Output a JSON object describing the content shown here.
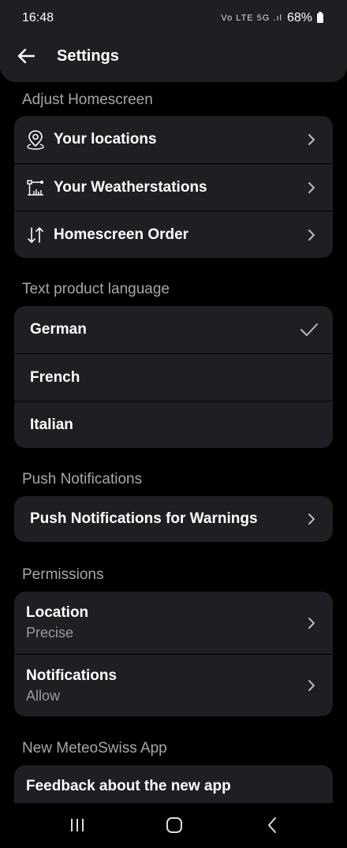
{
  "status": {
    "time": "16:48",
    "battery": "68%",
    "icons": "Vo LTE 5G .ıl"
  },
  "appbar": {
    "title": "Settings"
  },
  "sections": {
    "homescreen": {
      "title": "Adjust Homescreen",
      "items": [
        {
          "label": "Your locations",
          "icon": "location-pin-icon"
        },
        {
          "label": "Your Weatherstations",
          "icon": "weatherstation-icon"
        },
        {
          "label": "Homescreen Order",
          "icon": "sort-arrows-icon"
        }
      ]
    },
    "language": {
      "title": "Text product language",
      "items": [
        {
          "label": "German",
          "selected": true
        },
        {
          "label": "French",
          "selected": false
        },
        {
          "label": "Italian",
          "selected": false
        }
      ]
    },
    "push": {
      "title": "Push Notifications",
      "items": [
        {
          "label": "Push Notifications for Warnings"
        }
      ]
    },
    "permissions": {
      "title": "Permissions",
      "items": [
        {
          "label": "Location",
          "value": "Precise"
        },
        {
          "label": "Notifications",
          "value": "Allow"
        }
      ]
    },
    "newapp": {
      "title": "New MeteoSwiss App",
      "items": [
        {
          "label": "Feedback about the new app"
        }
      ]
    }
  },
  "colors": {
    "background": "#000000",
    "card": "#1e1f23",
    "section_title": "#a7a7ab",
    "subtitle": "#9a9a9e"
  }
}
